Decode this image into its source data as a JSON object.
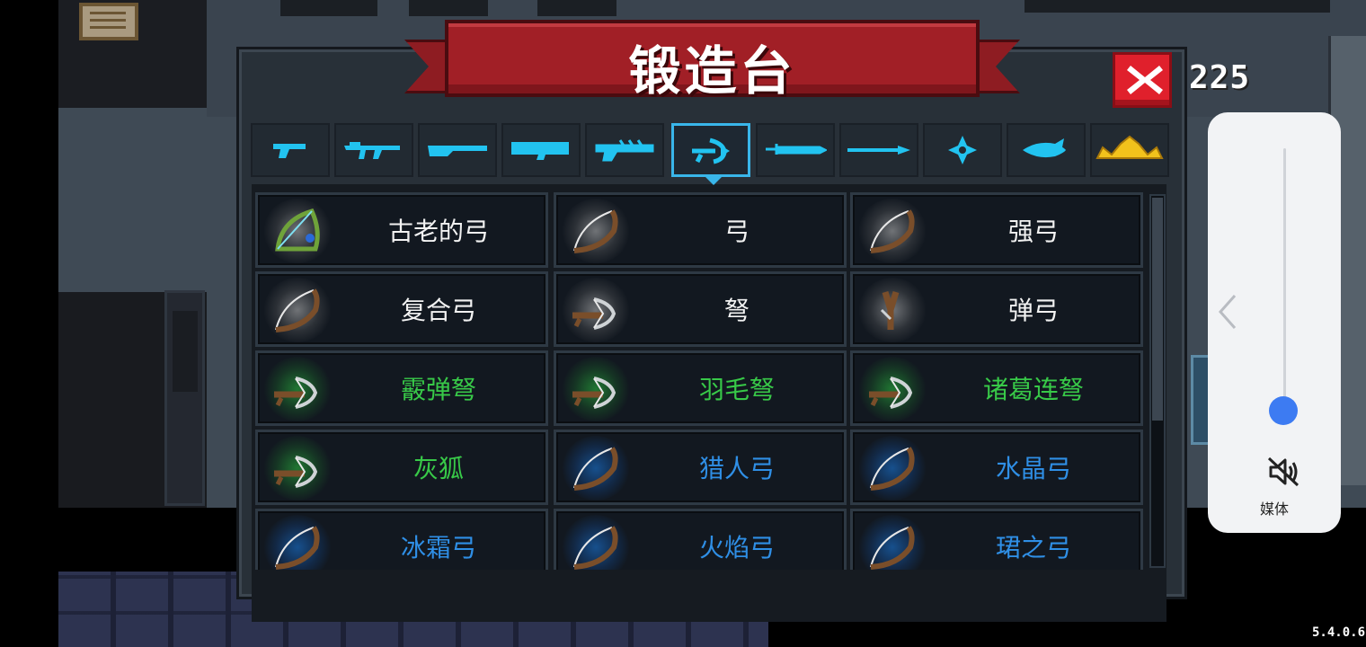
{
  "header": {
    "title": "锻造台",
    "coins": "225"
  },
  "colors": {
    "accent": "#39b6ea",
    "banner_red": "#a11f26",
    "close_red": "#e0202c",
    "rarity_white": "#f2f2f2",
    "rarity_green": "#38c948",
    "rarity_blue": "#2f8fe6"
  },
  "tabs": [
    {
      "icon": "pistol-icon",
      "active": false
    },
    {
      "icon": "assault-rifle-icon",
      "active": false
    },
    {
      "icon": "shotgun-icon",
      "active": false
    },
    {
      "icon": "launcher-icon",
      "active": false
    },
    {
      "icon": "laser-gun-icon",
      "active": false
    },
    {
      "icon": "bow-icon",
      "active": true
    },
    {
      "icon": "sword-icon",
      "active": false
    },
    {
      "icon": "spear-icon",
      "active": false
    },
    {
      "icon": "shuriken-icon",
      "active": false
    },
    {
      "icon": "fish-icon",
      "active": false
    },
    {
      "icon": "crown-icon",
      "active": false
    }
  ],
  "weapons": [
    {
      "name": "古老的弓",
      "rarity": "white",
      "icon": "ancient-bow-icon"
    },
    {
      "name": "弓",
      "rarity": "white",
      "icon": "bow-icon"
    },
    {
      "name": "强弓",
      "rarity": "white",
      "icon": "strong-bow-icon"
    },
    {
      "name": "复合弓",
      "rarity": "white",
      "icon": "compound-bow-icon"
    },
    {
      "name": "弩",
      "rarity": "white",
      "icon": "crossbow-icon"
    },
    {
      "name": "弹弓",
      "rarity": "white",
      "icon": "slingshot-icon"
    },
    {
      "name": "霰弹弩",
      "rarity": "green",
      "icon": "crossbow-icon"
    },
    {
      "name": "羽毛弩",
      "rarity": "green",
      "icon": "crossbow-icon"
    },
    {
      "name": "诸葛连弩",
      "rarity": "green",
      "icon": "crossbow-icon"
    },
    {
      "name": "灰狐",
      "rarity": "green",
      "icon": "crossbow-icon"
    },
    {
      "name": "猎人弓",
      "rarity": "blue",
      "icon": "bow-icon"
    },
    {
      "name": "水晶弓",
      "rarity": "blue",
      "icon": "bow-icon"
    },
    {
      "name": "冰霜弓",
      "rarity": "blue",
      "icon": "bow-icon"
    },
    {
      "name": "火焰弓",
      "rarity": "blue",
      "icon": "bow-icon"
    },
    {
      "name": "珺之弓",
      "rarity": "blue",
      "icon": "bow-icon"
    }
  ],
  "scrollbar": {
    "position": 0
  },
  "volume": {
    "label": "媒体",
    "level": 0,
    "muted": true,
    "mute_icon": "speaker-muted-icon",
    "collapse_icon": "chevron-left-icon"
  },
  "version": "5.4.0.6"
}
